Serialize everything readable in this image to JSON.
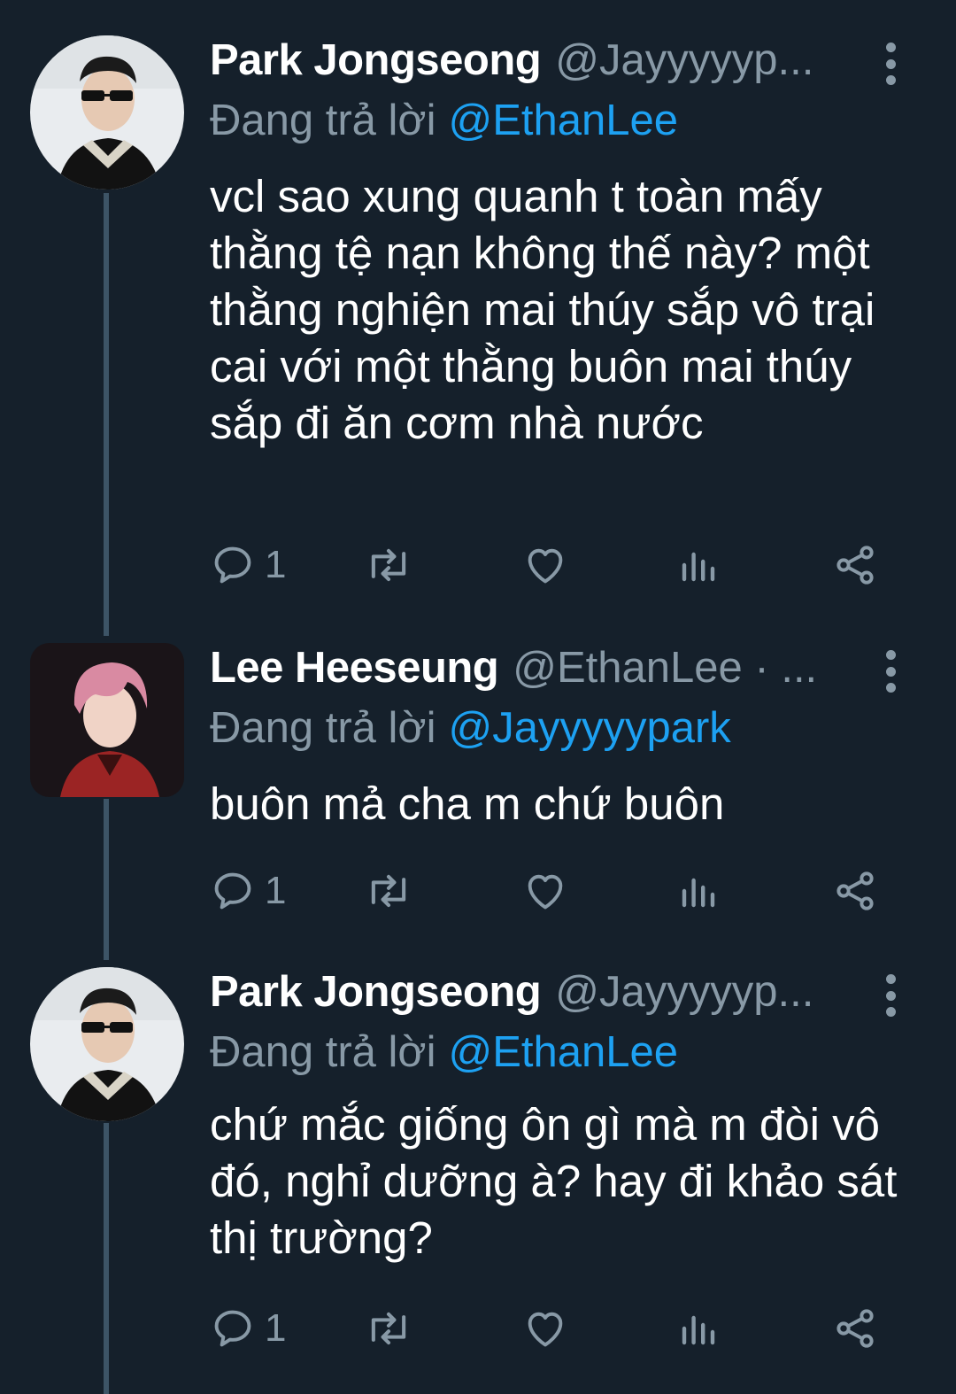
{
  "tweets": [
    {
      "name": "Park Jongseong",
      "handle": "@Jayyyyyp...",
      "reply_prefix": "Đang trả lời",
      "reply_to": "@EthanLee",
      "text": "vcl sao xung quanh t toàn mấy thằng tệ nạn không thế này? một thằng nghiện mai thúy sắp vô trại cai với một thằng buôn mai thúy sắp đi ăn cơm nhà nước",
      "reply_count": "1",
      "avatar": "avatar-park-sunglasses"
    },
    {
      "name": "Lee Heeseung",
      "handle": "@EthanLee · ...",
      "reply_prefix": "Đang trả lời",
      "reply_to": "@Jayyyyypark",
      "text": "buôn mả cha m chứ buôn",
      "reply_count": "1",
      "avatar": "avatar-lee-pink-hair"
    },
    {
      "name": "Park Jongseong",
      "handle": "@Jayyyyyp...",
      "reply_prefix": "Đang trả lời",
      "reply_to": "@EthanLee",
      "text": "chứ mắc giống ôn gì mà m đòi vô đó, nghỉ dưỡng à? hay đi khảo sát thị trường?",
      "reply_count": "1",
      "avatar": "avatar-park-sunglasses"
    }
  ],
  "colors": {
    "background": "#15202b",
    "secondary_text": "#8899a6",
    "link": "#1da1f2",
    "thread_line": "#3d5466"
  }
}
